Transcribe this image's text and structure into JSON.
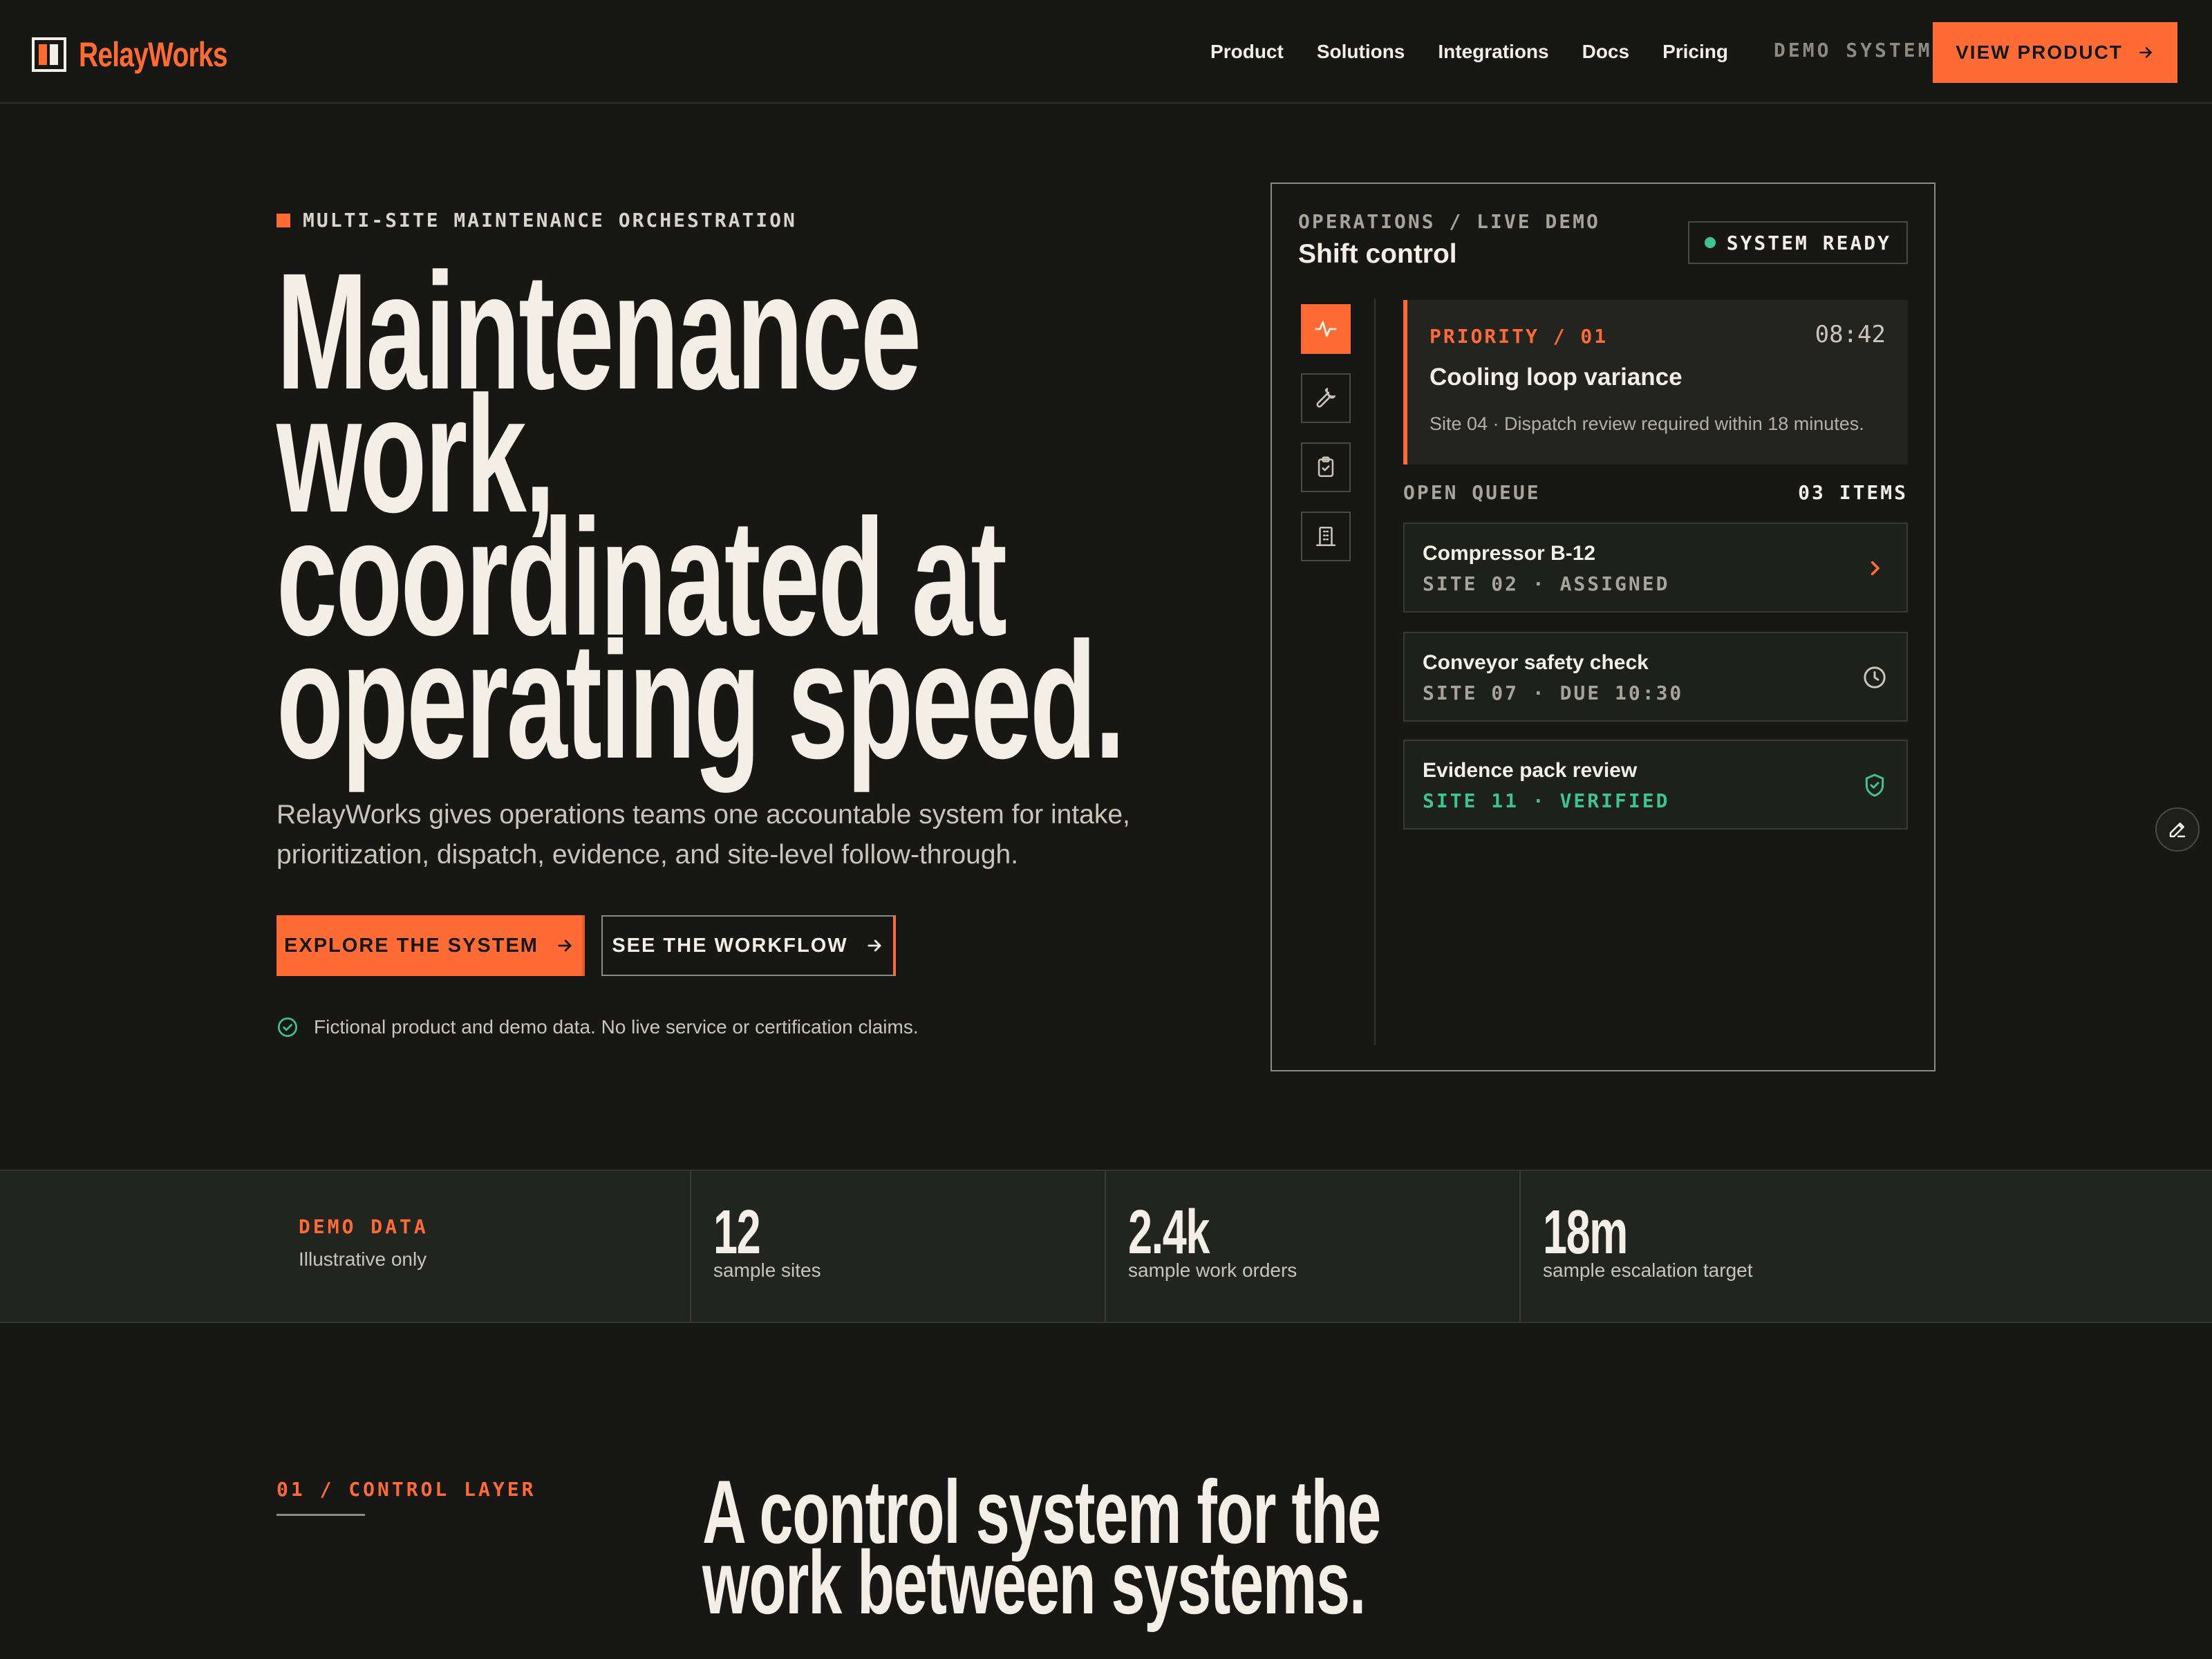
{
  "nav": {
    "brand": "RelayWorks",
    "links": [
      "Product",
      "Solutions",
      "Integrations",
      "Docs",
      "Pricing"
    ],
    "demo_label": "DEMO SYSTEM",
    "cta": "VIEW PRODUCT"
  },
  "hero": {
    "eyebrow": "MULTI-SITE MAINTENANCE ORCHESTRATION",
    "title_lines": [
      "Maintenance",
      "work,",
      "coordinated at",
      "operating speed."
    ],
    "subtitle": "RelayWorks gives operations teams one accountable system for intake, prioritization, dispatch, evidence, and site-level follow-through.",
    "primary_cta": "EXPLORE THE SYSTEM",
    "secondary_cta": "SEE THE WORKFLOW",
    "disclaimer": "Fictional product and demo data. No live service or certification claims."
  },
  "panel": {
    "eyebrow": "OPERATIONS / LIVE DEMO",
    "title": "Shift control",
    "status": "SYSTEM READY",
    "side_icons": [
      "pulse-icon",
      "wrench-icon",
      "clipboard-check-icon",
      "building-icon"
    ],
    "priority": {
      "label": "PRIORITY / 01",
      "time": "08:42",
      "title": "Cooling loop variance",
      "description": "Site 04 · Dispatch review required within 18 minutes."
    },
    "queue": {
      "label": "OPEN QUEUE",
      "count": "03 ITEMS",
      "items": [
        {
          "title": "Compressor B-12",
          "status": "SITE 02 · ASSIGNED",
          "icon": "chevron-right-icon"
        },
        {
          "title": "Conveyor safety check",
          "status": "SITE 07 · DUE 10:30",
          "icon": "clock-icon"
        },
        {
          "title": "Evidence pack review",
          "status": "SITE 11 · VERIFIED",
          "icon": "shield-check-icon"
        }
      ]
    }
  },
  "stats": {
    "label": "DEMO DATA",
    "note": "Illustrative only",
    "items": [
      {
        "value": "12",
        "caption": "sample sites"
      },
      {
        "value": "2.4k",
        "caption": "sample work orders"
      },
      {
        "value": "18m",
        "caption": "sample escalation target"
      }
    ]
  },
  "section": {
    "eyebrow": "01 / CONTROL LAYER",
    "title_lines": [
      "A control system for the",
      "work between systems."
    ]
  },
  "colors": {
    "background": "#171715",
    "accent": "#ff6b35",
    "success": "#3ec48c",
    "text": "#f3efe6"
  }
}
